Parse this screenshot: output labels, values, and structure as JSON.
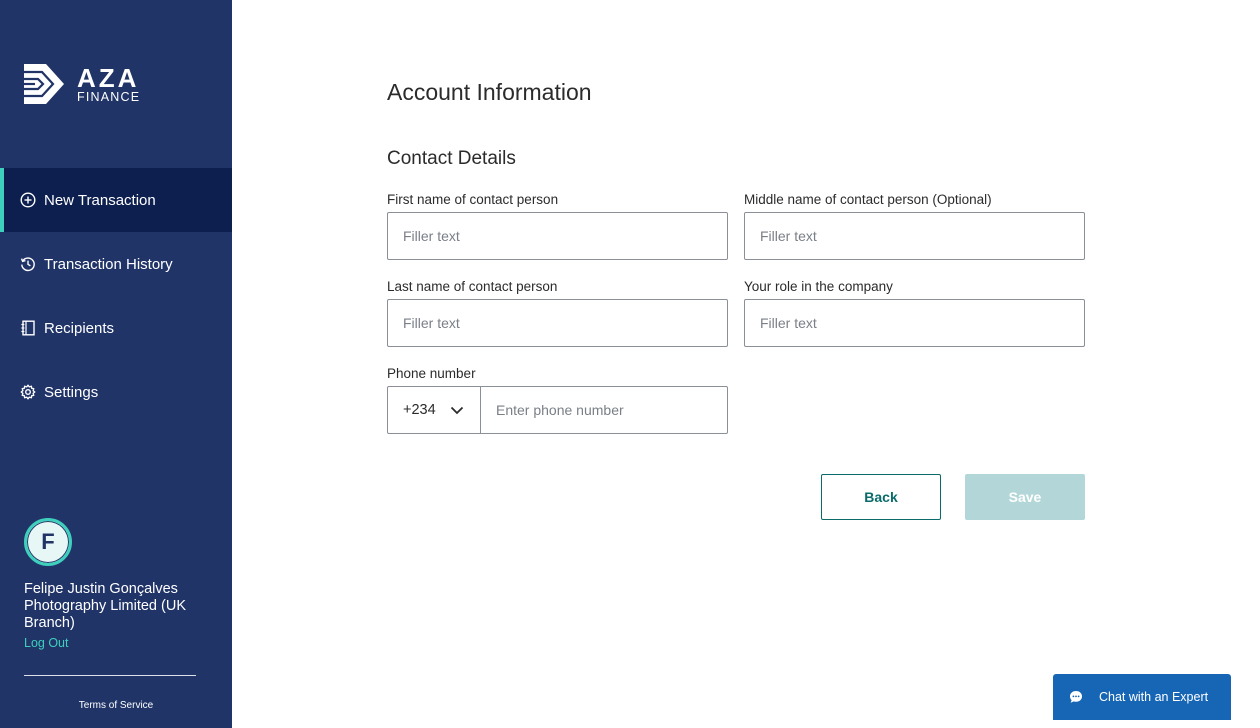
{
  "brand": {
    "name": "AZA",
    "tagline": "FINANCE"
  },
  "sidebar": {
    "items": [
      {
        "label": "New Transaction",
        "icon": "plus-circle-icon",
        "active": true
      },
      {
        "label": "Transaction History",
        "icon": "history-icon",
        "active": false
      },
      {
        "label": "Recipients",
        "icon": "address-book-icon",
        "active": false
      },
      {
        "label": "Settings",
        "icon": "gear-icon",
        "active": false
      }
    ]
  },
  "user": {
    "initial": "F",
    "name": "Felipe Justin Gonçalves Photography Limited (UK Branch)",
    "logout_label": "Log Out"
  },
  "footer": {
    "terms_label": "Terms of Service"
  },
  "page": {
    "title": "Account Information",
    "section_title": "Contact Details"
  },
  "form": {
    "first_name": {
      "label": "First name of contact person",
      "placeholder": "Filler text",
      "value": ""
    },
    "middle_name": {
      "label": "Middle name of contact person (Optional)",
      "placeholder": "Filler text",
      "value": ""
    },
    "last_name": {
      "label": "Last name of contact person",
      "placeholder": "Filler text",
      "value": ""
    },
    "role": {
      "label": "Your role in the company",
      "placeholder": "Filler text",
      "value": ""
    },
    "phone": {
      "label": "Phone number",
      "country_code": "+234",
      "placeholder": "Enter phone number",
      "value": ""
    }
  },
  "actions": {
    "back_label": "Back",
    "save_label": "Save"
  },
  "chat": {
    "label": "Chat with an Expert",
    "icon": "chat-bubble-icon"
  },
  "colors": {
    "sidebar_bg": "#203468",
    "sidebar_active_bg": "#0d1f4f",
    "accent": "#3fcfbd",
    "primary_teal": "#0b6b6b",
    "save_disabled": "#b3d7d8",
    "chat_blue": "#1766b5"
  }
}
